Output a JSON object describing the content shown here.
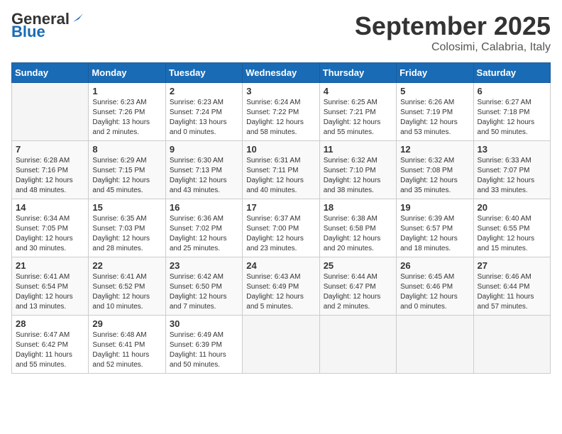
{
  "logo": {
    "general": "General",
    "blue": "Blue"
  },
  "header": {
    "month": "September 2025",
    "location": "Colosimi, Calabria, Italy"
  },
  "weekdays": [
    "Sunday",
    "Monday",
    "Tuesday",
    "Wednesday",
    "Thursday",
    "Friday",
    "Saturday"
  ],
  "weeks": [
    [
      {
        "day": null
      },
      {
        "day": "1",
        "sunrise": "Sunrise: 6:23 AM",
        "sunset": "Sunset: 7:26 PM",
        "daylight": "Daylight: 13 hours and 2 minutes."
      },
      {
        "day": "2",
        "sunrise": "Sunrise: 6:23 AM",
        "sunset": "Sunset: 7:24 PM",
        "daylight": "Daylight: 13 hours and 0 minutes."
      },
      {
        "day": "3",
        "sunrise": "Sunrise: 6:24 AM",
        "sunset": "Sunset: 7:22 PM",
        "daylight": "Daylight: 12 hours and 58 minutes."
      },
      {
        "day": "4",
        "sunrise": "Sunrise: 6:25 AM",
        "sunset": "Sunset: 7:21 PM",
        "daylight": "Daylight: 12 hours and 55 minutes."
      },
      {
        "day": "5",
        "sunrise": "Sunrise: 6:26 AM",
        "sunset": "Sunset: 7:19 PM",
        "daylight": "Daylight: 12 hours and 53 minutes."
      },
      {
        "day": "6",
        "sunrise": "Sunrise: 6:27 AM",
        "sunset": "Sunset: 7:18 PM",
        "daylight": "Daylight: 12 hours and 50 minutes."
      }
    ],
    [
      {
        "day": "7",
        "sunrise": "Sunrise: 6:28 AM",
        "sunset": "Sunset: 7:16 PM",
        "daylight": "Daylight: 12 hours and 48 minutes."
      },
      {
        "day": "8",
        "sunrise": "Sunrise: 6:29 AM",
        "sunset": "Sunset: 7:15 PM",
        "daylight": "Daylight: 12 hours and 45 minutes."
      },
      {
        "day": "9",
        "sunrise": "Sunrise: 6:30 AM",
        "sunset": "Sunset: 7:13 PM",
        "daylight": "Daylight: 12 hours and 43 minutes."
      },
      {
        "day": "10",
        "sunrise": "Sunrise: 6:31 AM",
        "sunset": "Sunset: 7:11 PM",
        "daylight": "Daylight: 12 hours and 40 minutes."
      },
      {
        "day": "11",
        "sunrise": "Sunrise: 6:32 AM",
        "sunset": "Sunset: 7:10 PM",
        "daylight": "Daylight: 12 hours and 38 minutes."
      },
      {
        "day": "12",
        "sunrise": "Sunrise: 6:32 AM",
        "sunset": "Sunset: 7:08 PM",
        "daylight": "Daylight: 12 hours and 35 minutes."
      },
      {
        "day": "13",
        "sunrise": "Sunrise: 6:33 AM",
        "sunset": "Sunset: 7:07 PM",
        "daylight": "Daylight: 12 hours and 33 minutes."
      }
    ],
    [
      {
        "day": "14",
        "sunrise": "Sunrise: 6:34 AM",
        "sunset": "Sunset: 7:05 PM",
        "daylight": "Daylight: 12 hours and 30 minutes."
      },
      {
        "day": "15",
        "sunrise": "Sunrise: 6:35 AM",
        "sunset": "Sunset: 7:03 PM",
        "daylight": "Daylight: 12 hours and 28 minutes."
      },
      {
        "day": "16",
        "sunrise": "Sunrise: 6:36 AM",
        "sunset": "Sunset: 7:02 PM",
        "daylight": "Daylight: 12 hours and 25 minutes."
      },
      {
        "day": "17",
        "sunrise": "Sunrise: 6:37 AM",
        "sunset": "Sunset: 7:00 PM",
        "daylight": "Daylight: 12 hours and 23 minutes."
      },
      {
        "day": "18",
        "sunrise": "Sunrise: 6:38 AM",
        "sunset": "Sunset: 6:58 PM",
        "daylight": "Daylight: 12 hours and 20 minutes."
      },
      {
        "day": "19",
        "sunrise": "Sunrise: 6:39 AM",
        "sunset": "Sunset: 6:57 PM",
        "daylight": "Daylight: 12 hours and 18 minutes."
      },
      {
        "day": "20",
        "sunrise": "Sunrise: 6:40 AM",
        "sunset": "Sunset: 6:55 PM",
        "daylight": "Daylight: 12 hours and 15 minutes."
      }
    ],
    [
      {
        "day": "21",
        "sunrise": "Sunrise: 6:41 AM",
        "sunset": "Sunset: 6:54 PM",
        "daylight": "Daylight: 12 hours and 13 minutes."
      },
      {
        "day": "22",
        "sunrise": "Sunrise: 6:41 AM",
        "sunset": "Sunset: 6:52 PM",
        "daylight": "Daylight: 12 hours and 10 minutes."
      },
      {
        "day": "23",
        "sunrise": "Sunrise: 6:42 AM",
        "sunset": "Sunset: 6:50 PM",
        "daylight": "Daylight: 12 hours and 7 minutes."
      },
      {
        "day": "24",
        "sunrise": "Sunrise: 6:43 AM",
        "sunset": "Sunset: 6:49 PM",
        "daylight": "Daylight: 12 hours and 5 minutes."
      },
      {
        "day": "25",
        "sunrise": "Sunrise: 6:44 AM",
        "sunset": "Sunset: 6:47 PM",
        "daylight": "Daylight: 12 hours and 2 minutes."
      },
      {
        "day": "26",
        "sunrise": "Sunrise: 6:45 AM",
        "sunset": "Sunset: 6:46 PM",
        "daylight": "Daylight: 12 hours and 0 minutes."
      },
      {
        "day": "27",
        "sunrise": "Sunrise: 6:46 AM",
        "sunset": "Sunset: 6:44 PM",
        "daylight": "Daylight: 11 hours and 57 minutes."
      }
    ],
    [
      {
        "day": "28",
        "sunrise": "Sunrise: 6:47 AM",
        "sunset": "Sunset: 6:42 PM",
        "daylight": "Daylight: 11 hours and 55 minutes."
      },
      {
        "day": "29",
        "sunrise": "Sunrise: 6:48 AM",
        "sunset": "Sunset: 6:41 PM",
        "daylight": "Daylight: 11 hours and 52 minutes."
      },
      {
        "day": "30",
        "sunrise": "Sunrise: 6:49 AM",
        "sunset": "Sunset: 6:39 PM",
        "daylight": "Daylight: 11 hours and 50 minutes."
      },
      {
        "day": null
      },
      {
        "day": null
      },
      {
        "day": null
      },
      {
        "day": null
      }
    ]
  ]
}
